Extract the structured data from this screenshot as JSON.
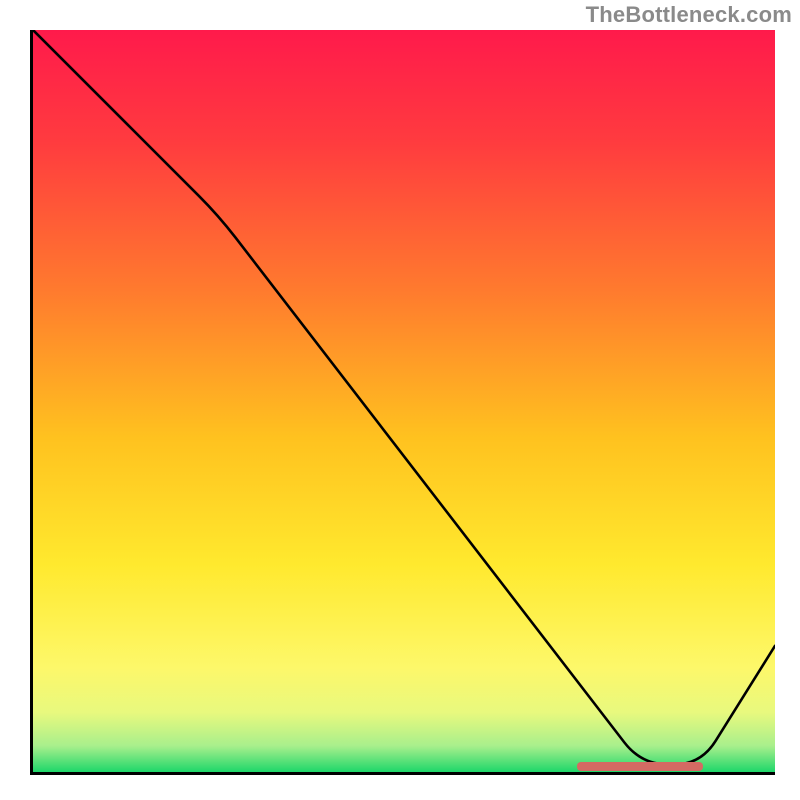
{
  "watermark": "TheBottleneck.com",
  "chart_data": {
    "type": "line",
    "title": "",
    "xlabel": "",
    "ylabel": "",
    "x_range": [
      0,
      100
    ],
    "y_range": [
      0,
      100
    ],
    "series": [
      {
        "name": "curve",
        "x": [
          0,
          25,
          82,
          90,
          100
        ],
        "y": [
          100,
          75,
          1,
          1,
          17
        ]
      }
    ],
    "marker": {
      "x_start": 73,
      "x_end": 90,
      "y": 1.2
    },
    "gradient_stops": [
      {
        "pos": 0.0,
        "color": "#ff1a4b"
      },
      {
        "pos": 0.15,
        "color": "#ff3b3f"
      },
      {
        "pos": 0.35,
        "color": "#ff7a2e"
      },
      {
        "pos": 0.55,
        "color": "#ffc21f"
      },
      {
        "pos": 0.72,
        "color": "#ffe92e"
      },
      {
        "pos": 0.86,
        "color": "#fdf86a"
      },
      {
        "pos": 0.92,
        "color": "#e8f97e"
      },
      {
        "pos": 0.965,
        "color": "#a8ef8c"
      },
      {
        "pos": 1.0,
        "color": "#1ed76a"
      }
    ]
  }
}
